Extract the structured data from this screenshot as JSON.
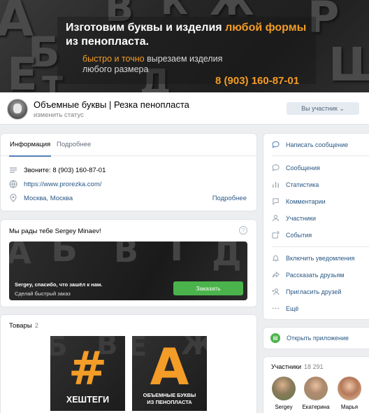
{
  "cover": {
    "headline_1": "Изготовим буквы и изделия ",
    "headline_accent": "любой формы",
    "headline_2": "из пенопласта.",
    "sub_accent": "быстро и точно",
    "sub_1": " вырезаем изделия",
    "sub_2": "любого размера",
    "phone": "8 (903) 160-87-01"
  },
  "header": {
    "group_name": "Объемные буквы | Резка пенопласта",
    "status_link": "изменить статус",
    "member_button": "Вы участник ⌄"
  },
  "info": {
    "tabs": [
      "Информация",
      "Подробнее"
    ],
    "phone": "Звоните: 8 (903) 160-87-01",
    "website": "https://www.prorezka.com/",
    "location": "Москва, Москва",
    "more": "Подробнее"
  },
  "welcome": {
    "title": "Мы рады тебе Sergey Minaev!",
    "help": "?",
    "message": "Sergey, спасибо, что зашёл к нам.",
    "message_2": "Сделай быстрый заказ",
    "order_button": "Заказать"
  },
  "goods": {
    "title": "Товары",
    "count": "2",
    "items": [
      {
        "big": "#",
        "caption": "ХЕШТЕГИ"
      },
      {
        "big": "A",
        "caption": "ОБЪЕМНЫЕ БУКВЫ",
        "caption_2": "ИЗ ПЕНОПЛАСТА"
      }
    ]
  },
  "menu": {
    "write": "Написать сообщение",
    "messages": "Сообщения",
    "stats": "Статистика",
    "comments": "Комментарии",
    "members": "Участники",
    "events": "События",
    "notify": "Включить уведомления",
    "tell": "Рассказать друзьям",
    "invite": "Пригласить друзей",
    "more": "Ещё"
  },
  "app": {
    "label": "Открыть приложение"
  },
  "members": {
    "title": "Участники",
    "count": "18 291",
    "people": [
      "Sergey",
      "Екатерина",
      "Марья"
    ]
  }
}
